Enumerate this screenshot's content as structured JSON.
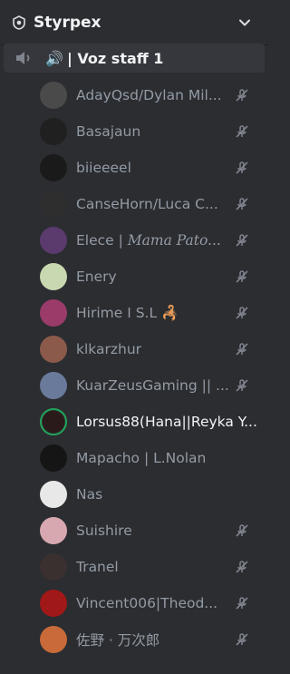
{
  "header": {
    "server_name": "Styrpex",
    "server_icon": "shield-icon",
    "menu_icon": "chevron-down-icon"
  },
  "channel": {
    "speaker_emoji": "🔊",
    "name": "| Voz staff 1",
    "volume_icon": "volume-icon"
  },
  "members": [
    {
      "name": "AdayQsd/Dylan Mil...",
      "muted": true,
      "avatar": "#4a4a4a"
    },
    {
      "name": "Basajaun",
      "muted": true,
      "avatar": "#202020"
    },
    {
      "name": "biieeeel",
      "muted": true,
      "avatar": "#1a1a1a"
    },
    {
      "name": "CanseHorn/Luca C...",
      "muted": true,
      "avatar": "#2e2e2e"
    },
    {
      "name": "Elece | ",
      "name_italic": "Mama Pato...",
      "muted": true,
      "avatar": "#5b3a6e"
    },
    {
      "name": "Enery",
      "muted": true,
      "avatar": "#c8d8b0"
    },
    {
      "name": "Hirime I S.L",
      "suffix_emoji": "🦂",
      "muted": true,
      "avatar": "#9a3b6a"
    },
    {
      "name": "klkarzhur",
      "muted": true,
      "avatar": "#8b5a4a"
    },
    {
      "name": "KuarZeusGaming || ...",
      "muted": true,
      "avatar": "#6a7a9a"
    },
    {
      "name": "Lorsus88(Hana||Reyka Y...",
      "muted": false,
      "speaking": true,
      "avatar": "#2a1a1a"
    },
    {
      "name": "Mapacho | L.Nolan",
      "muted": false,
      "avatar": "#151515"
    },
    {
      "name": "Nas",
      "muted": false,
      "avatar": "#e8e8e8"
    },
    {
      "name": "Suishire",
      "muted": true,
      "avatar": "#d8a8b0"
    },
    {
      "name": "Tranel",
      "muted": true,
      "avatar": "#3a3030"
    },
    {
      "name": "Vincent006|Theod...",
      "muted": true,
      "avatar": "#a01818"
    },
    {
      "name": "佐野 · 万次郎",
      "muted": true,
      "avatar": "#c86a3a"
    }
  ],
  "colors": {
    "bg": "#2b2d31",
    "selected": "#35373c",
    "speaking_ring": "#23a55a",
    "text_muted": "#949ba4",
    "text_bright": "#f2f3f5"
  }
}
